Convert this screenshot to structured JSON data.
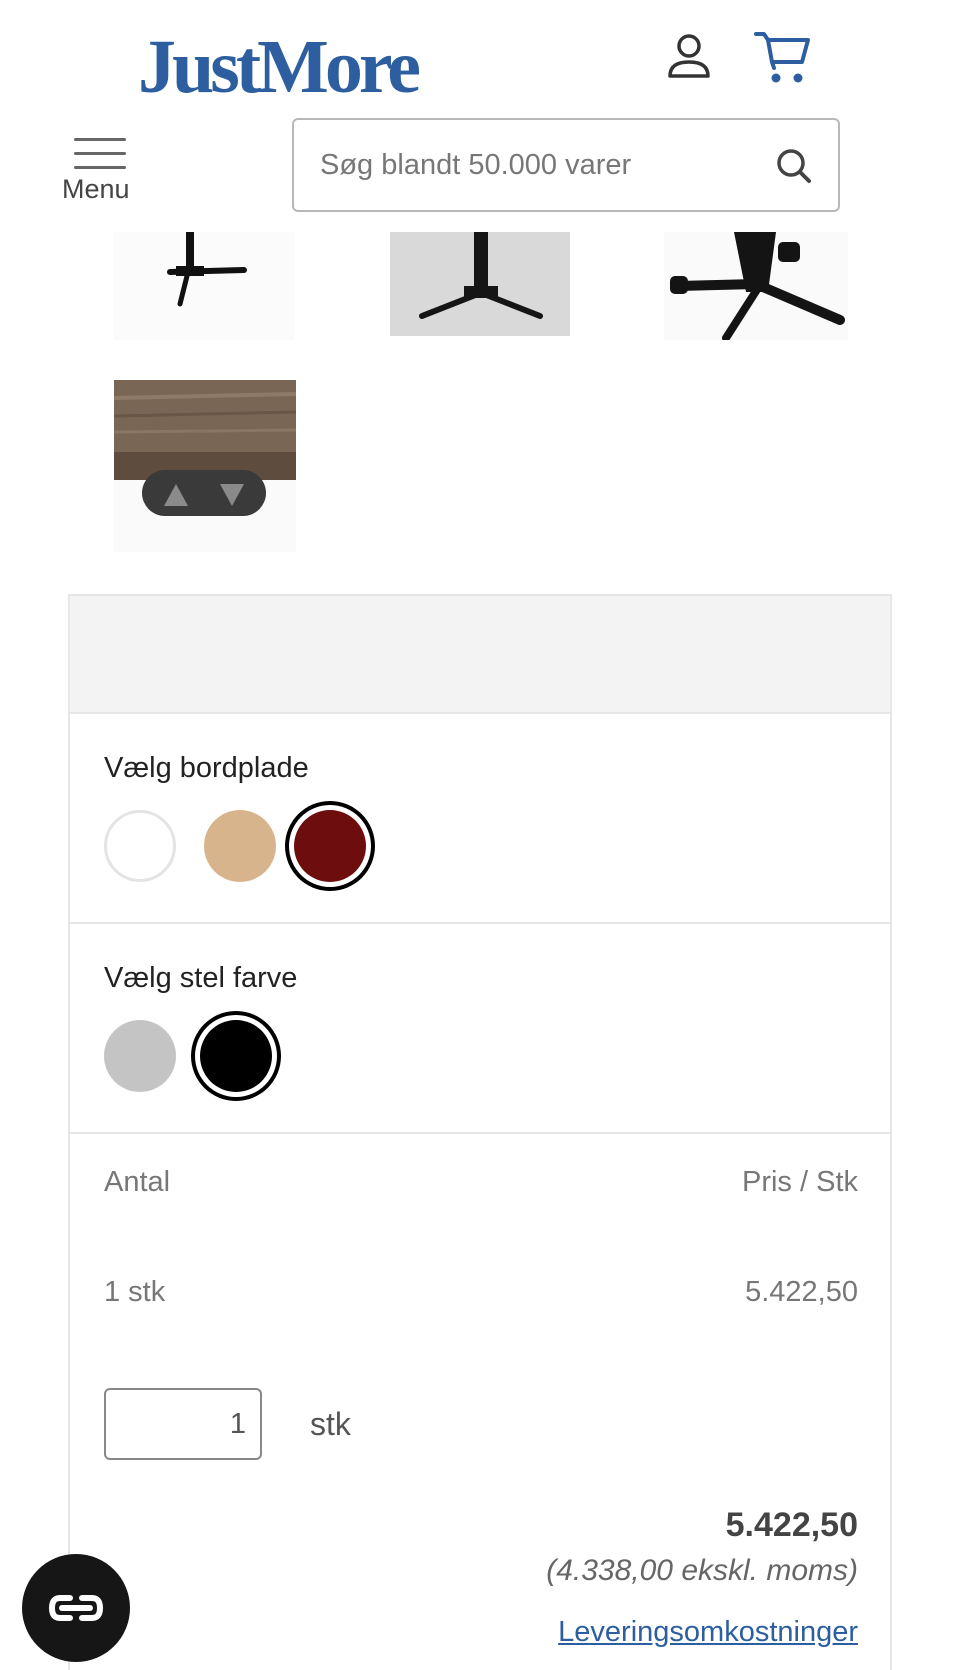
{
  "header": {
    "logo_text": "JustMore",
    "menu_label": "Menu",
    "search_placeholder": "Søg blandt 50.000 varer"
  },
  "options": {
    "tabletop": {
      "title": "Vælg bordplade",
      "swatches": [
        {
          "color": "#ffffff",
          "selected": false
        },
        {
          "color": "#d8b48c",
          "selected": false
        },
        {
          "color": "#6e0d0d",
          "selected": true
        }
      ]
    },
    "frame": {
      "title": "Vælg stel farve",
      "swatches": [
        {
          "color": "#c4c4c4",
          "selected": false
        },
        {
          "color": "#000000",
          "selected": true
        }
      ]
    }
  },
  "pricing": {
    "qty_header": "Antal",
    "price_header": "Pris / Stk",
    "qty_tier": "1 stk",
    "unit_price": "5.422,50",
    "quantity_value": "1",
    "quantity_unit": "stk",
    "total": "5.422,50",
    "ex_vat": "(4.338,00 ekskl. moms)",
    "delivery_link": "Leveringsomkostninger"
  },
  "colors": {
    "brand": "#2d5fa0"
  },
  "icons": {
    "user": "user-icon",
    "cart": "cart-icon",
    "menu": "hamburger-icon",
    "search": "search-icon",
    "chat": "chat-icon"
  }
}
